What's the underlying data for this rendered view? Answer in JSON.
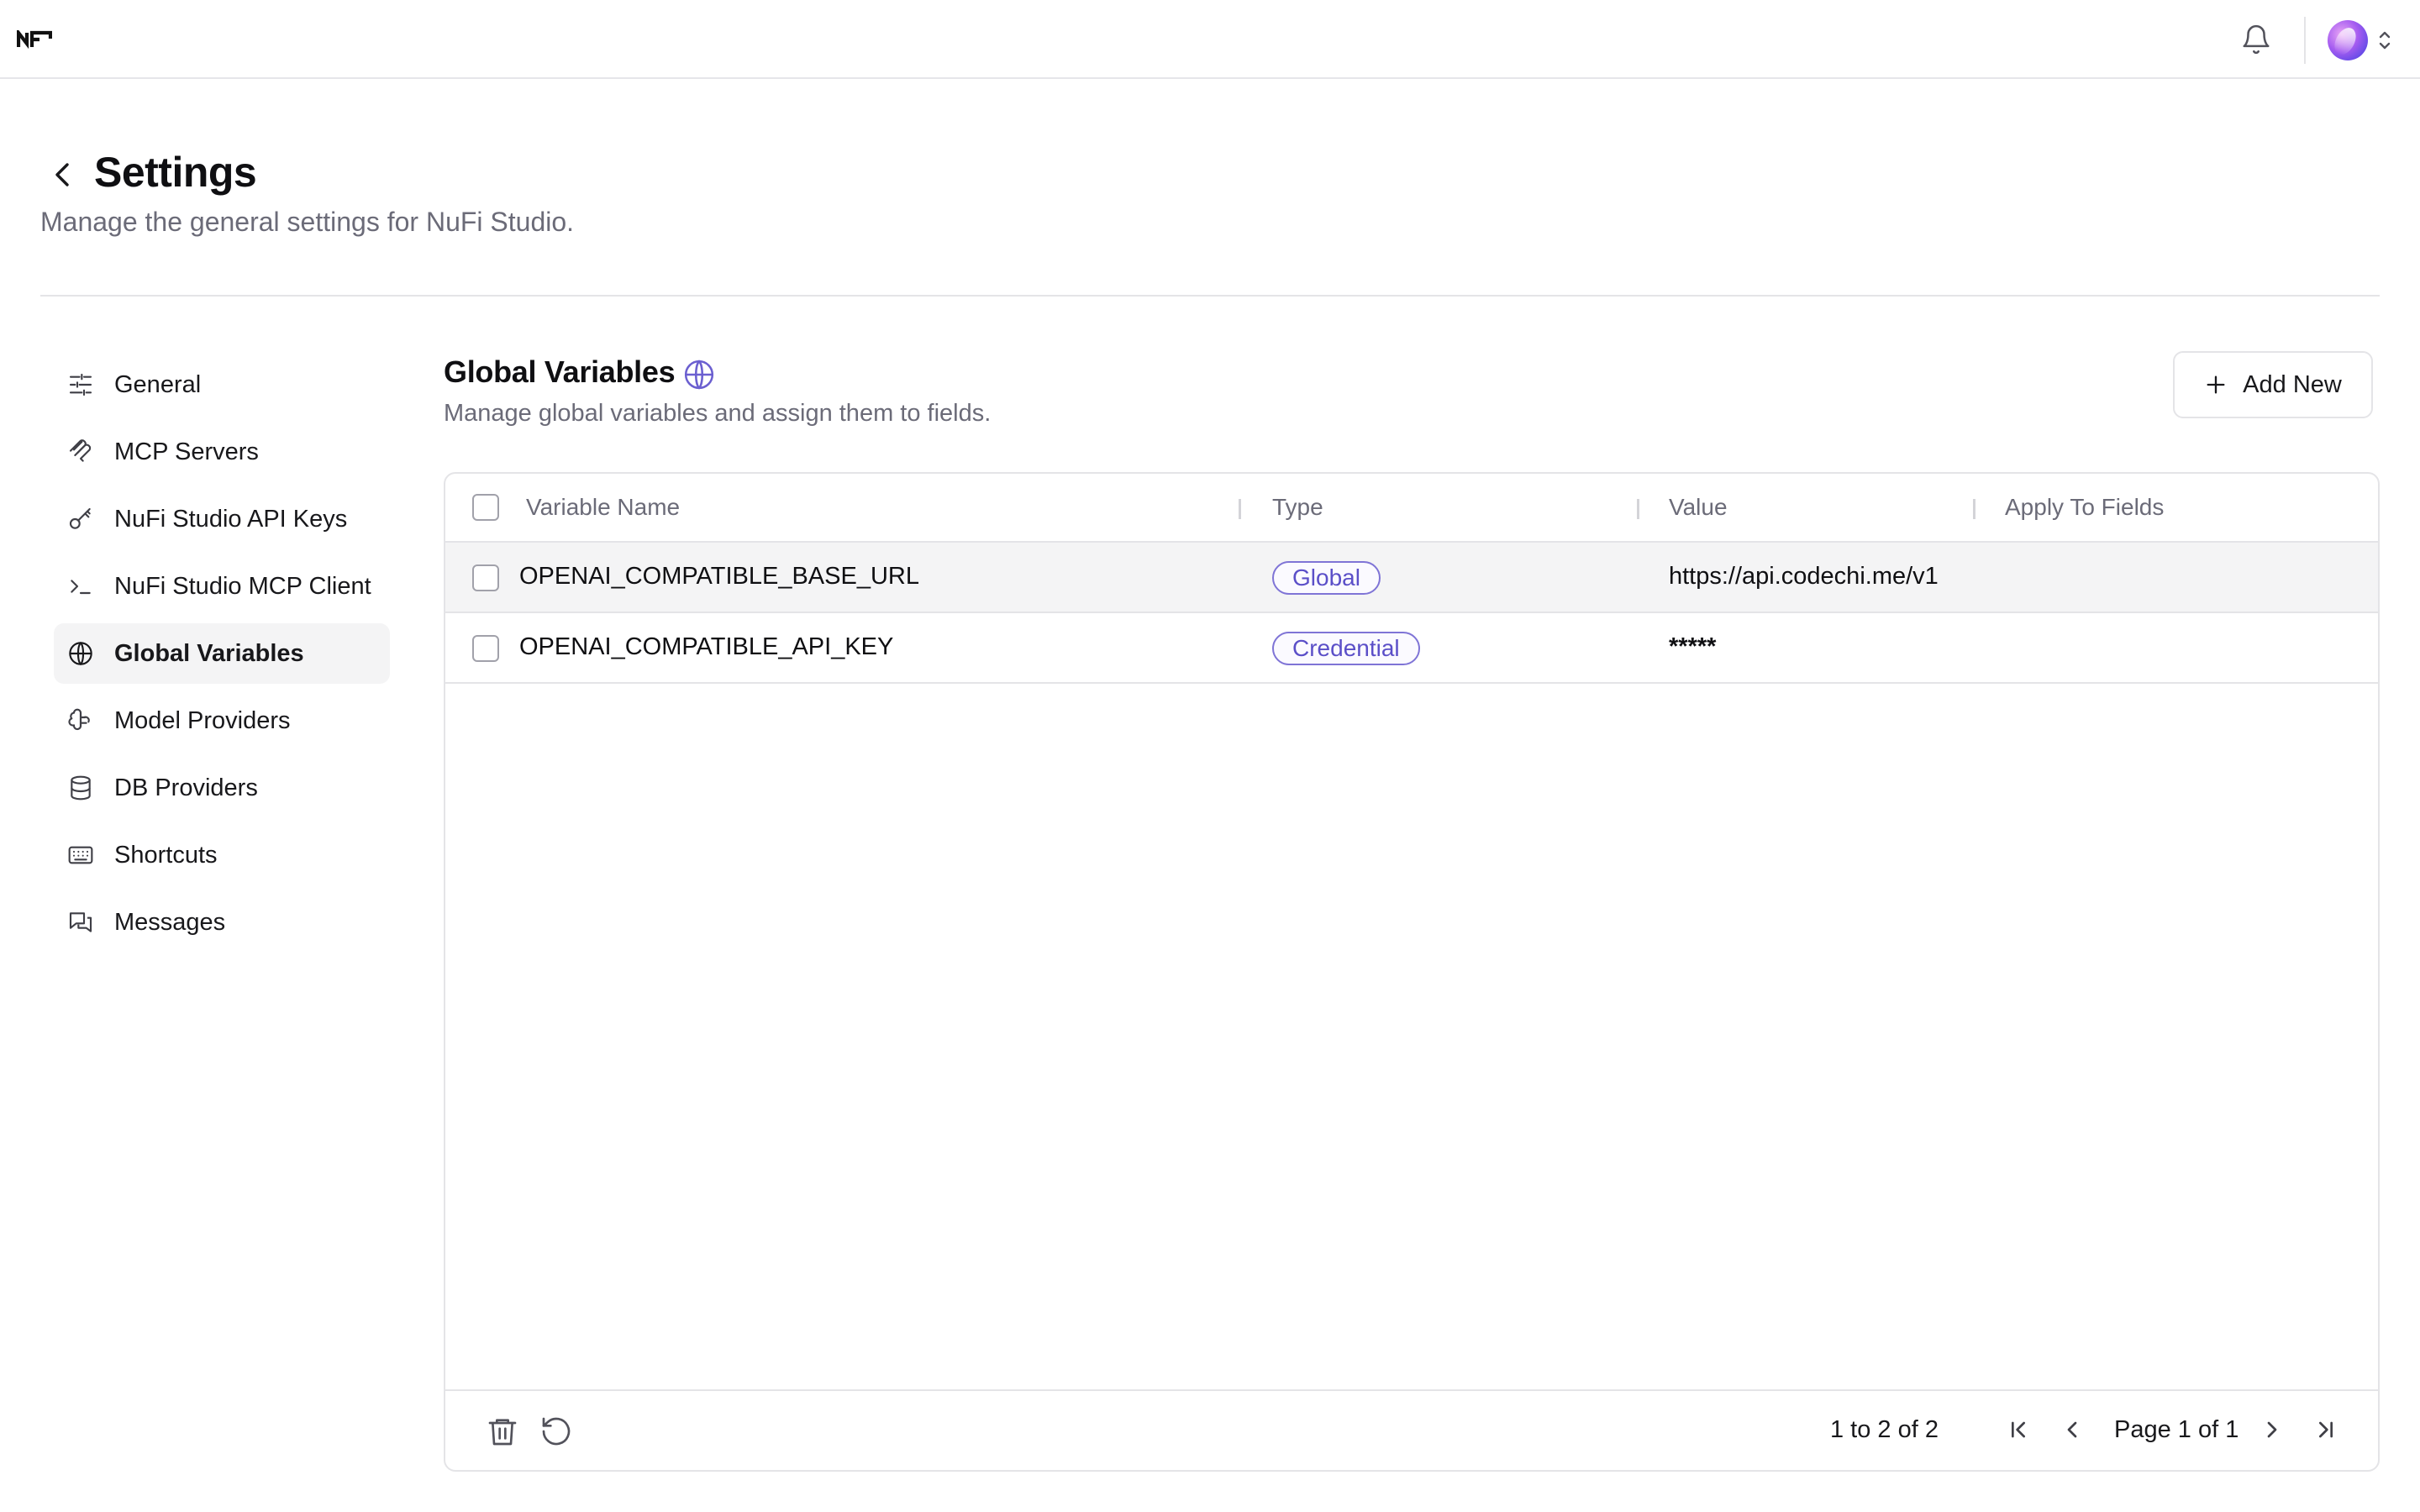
{
  "topbar": {
    "logo_text": "NF",
    "notifications_icon": "bell-icon",
    "avatar_icon": "avatar",
    "account_menu_icon": "chevron-up-down-icon"
  },
  "header": {
    "title": "Settings",
    "subtitle": "Manage the general settings for NuFi Studio."
  },
  "sidebar": {
    "items": [
      {
        "label": "General",
        "icon": "sliders-icon"
      },
      {
        "label": "MCP Servers",
        "icon": "mcp-icon"
      },
      {
        "label": "NuFi Studio API Keys",
        "icon": "key-icon"
      },
      {
        "label": "NuFi Studio MCP Client",
        "icon": "terminal-icon"
      },
      {
        "label": "Global Variables",
        "icon": "globe-icon",
        "active": true
      },
      {
        "label": "Model Providers",
        "icon": "brain-icon"
      },
      {
        "label": "DB Providers",
        "icon": "database-icon"
      },
      {
        "label": "Shortcuts",
        "icon": "keyboard-icon"
      },
      {
        "label": "Messages",
        "icon": "messages-icon"
      }
    ]
  },
  "section": {
    "title": "Global Variables",
    "description": "Manage global variables and assign them to fields.",
    "add_label": "Add New"
  },
  "table": {
    "columns": [
      "Variable Name",
      "Type",
      "Value",
      "Apply To Fields"
    ],
    "rows": [
      {
        "name": "OPENAI_COMPATIBLE_BASE_URL",
        "type": "Global",
        "value": "https://api.codechi.me/v1",
        "fields": ""
      },
      {
        "name": "OPENAI_COMPATIBLE_API_KEY",
        "type": "Credential",
        "value": "*****",
        "fields": ""
      }
    ],
    "footer": {
      "range_text": "1 to 2 of 2",
      "page_text": "Page 1 of 1"
    }
  },
  "colors": {
    "accent": "#5b4fc8",
    "border": "#e4e4e7",
    "muted_text": "#6b6b78"
  }
}
